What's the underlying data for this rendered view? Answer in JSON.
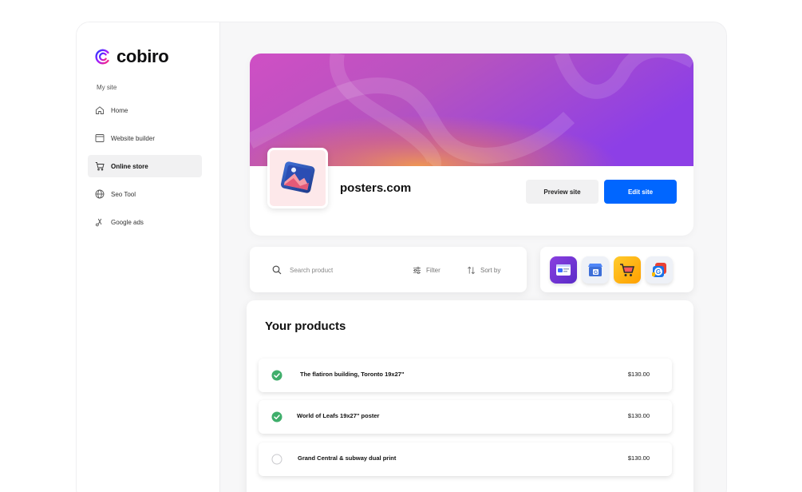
{
  "brand": {
    "name": "cobiro",
    "accent": "#0066ff"
  },
  "sidebar": {
    "section_label": "My site",
    "items": [
      {
        "label": "Home",
        "icon": "home-icon",
        "active": false
      },
      {
        "label": "Website builder",
        "icon": "browser-window-icon",
        "active": false
      },
      {
        "label": "Online store",
        "icon": "shopping-cart-icon",
        "active": true
      },
      {
        "label": "Seo Tool",
        "icon": "globe-icon",
        "active": false
      },
      {
        "label": "Google ads",
        "icon": "google-ads-icon",
        "active": false
      }
    ]
  },
  "site": {
    "name": "posters.com",
    "preview_label": "Preview site",
    "edit_label": "Edit site"
  },
  "search": {
    "placeholder": "Search product",
    "filter_label": "Filter",
    "sort_label": "Sort by"
  },
  "apps": [
    {
      "icon": "website-builder-app-icon"
    },
    {
      "icon": "google-my-business-app-icon"
    },
    {
      "icon": "shopping-cart-app-icon"
    },
    {
      "icon": "google-ads-app-icon"
    }
  ],
  "products": {
    "title": "Your products",
    "items": [
      {
        "name": "The flatiron building, Toronto 19x27\"",
        "price": "$130.00",
        "checked": true
      },
      {
        "name": "World of Leafs 19x27\" poster",
        "price": "$130.00",
        "checked": true
      },
      {
        "name": "Grand Central & subway dual print",
        "price": "$130.00",
        "checked": false
      }
    ]
  }
}
